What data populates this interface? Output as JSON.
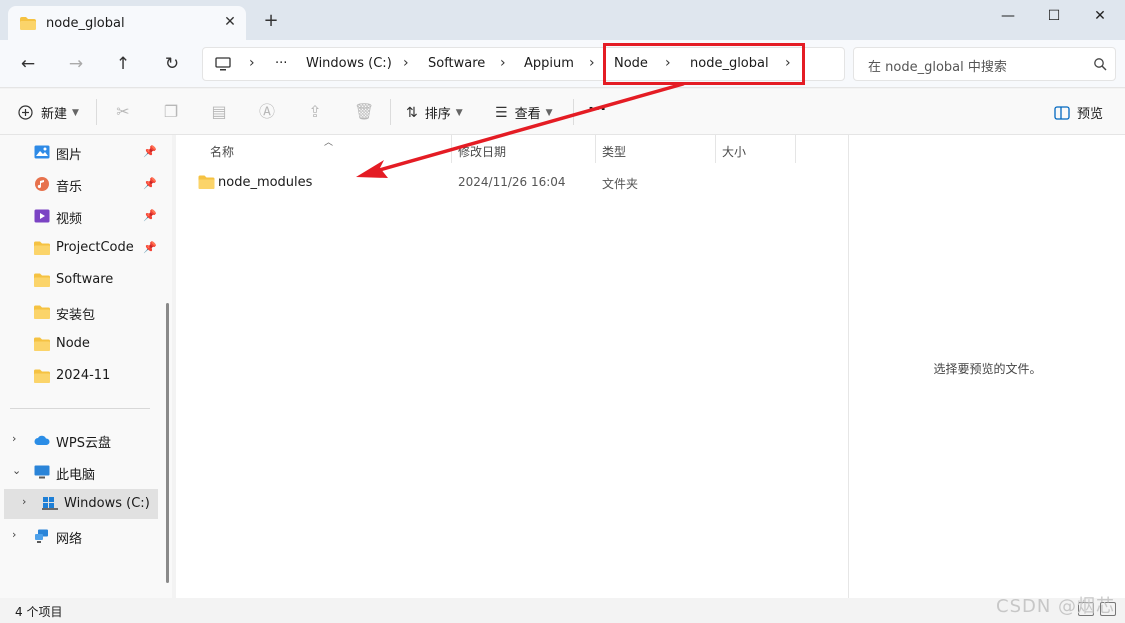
{
  "window": {
    "tab_title": "node_global",
    "tab_close": "✕",
    "new_tab": "+",
    "minimize": "—",
    "maximize": "☐",
    "close": "✕"
  },
  "nav": {
    "back": "←",
    "forward": "→",
    "up": "↑",
    "refresh": "↻",
    "more": "···",
    "breadcrumb": [
      "Windows (C:)",
      "Software",
      "Appium",
      "Node",
      "node_global"
    ],
    "separator": "›",
    "search_placeholder": "在 node_global 中搜索"
  },
  "toolbar": {
    "new_label": "新建",
    "sort_label": "排序",
    "view_label": "查看",
    "more_label": "···",
    "preview_label": "预览"
  },
  "sidebar": {
    "items": [
      {
        "label": "图片",
        "icon": "pictures-icon",
        "pinned": true
      },
      {
        "label": "音乐",
        "icon": "music-icon",
        "pinned": true
      },
      {
        "label": "视频",
        "icon": "video-icon",
        "pinned": true
      },
      {
        "label": "ProjectCode",
        "icon": "folder-icon",
        "pinned": true
      },
      {
        "label": "Software",
        "icon": "folder-icon",
        "pinned": false
      },
      {
        "label": "安装包",
        "icon": "folder-icon",
        "pinned": false
      },
      {
        "label": "Node",
        "icon": "folder-icon",
        "pinned": false
      },
      {
        "label": "2024-11",
        "icon": "folder-icon",
        "pinned": false
      }
    ],
    "tree": [
      {
        "label": "WPS云盘",
        "icon": "cloud-icon",
        "expanded": false
      },
      {
        "label": "此电脑",
        "icon": "this-pc-icon",
        "expanded": true
      },
      {
        "label": "Windows (C:)",
        "icon": "drive-icon",
        "expanded": false,
        "selected": true
      },
      {
        "label": "网络",
        "icon": "network-icon",
        "expanded": false
      }
    ]
  },
  "columns": {
    "name": "名称",
    "modified": "修改日期",
    "type": "类型",
    "size": "大小"
  },
  "files": [
    {
      "name": "node_modules",
      "modified": "2024/11/26 16:04",
      "type": "文件夹",
      "size": ""
    }
  ],
  "preview": {
    "message": "选择要预览的文件。"
  },
  "status": {
    "count": "4 个项目"
  },
  "watermark": "CSDN @烟芯",
  "colors": {
    "highlight": "#e41c24",
    "folder": "#f5c242",
    "accent": "#0067c0"
  }
}
